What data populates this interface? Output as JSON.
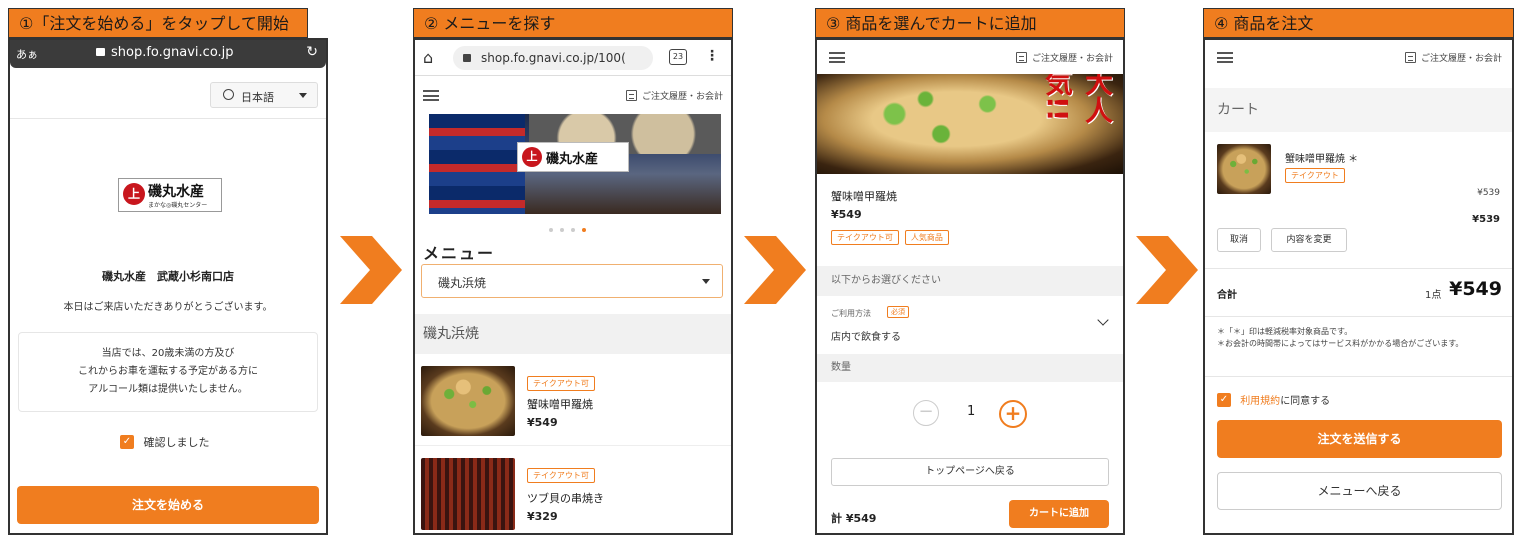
{
  "steps": [
    {
      "title": "①「注文を始める」をタップして開始"
    },
    {
      "title": "② メニューを探す"
    },
    {
      "title": "③ 商品を選んでカートに追加"
    },
    {
      "title": "④ 商品を注文"
    }
  ],
  "p1": {
    "kana": "あぁ",
    "url": "shop.fo.gnavi.co.jp",
    "lang": "日本語",
    "logo_main": "磯丸水産",
    "logo_sub": "まかな◎磯丸センター",
    "store": "磯丸水産　武蔵小杉南口店",
    "welcome": "本日はご来店いただきありがとうございます。",
    "notice": [
      "当店では、20歳未満の方及び",
      "これからお車を運転する予定がある方に",
      "アルコール類は提供いたしません。"
    ],
    "confirm": "確認しました",
    "start_button": "注文を始める"
  },
  "p2": {
    "url": "shop.fo.gnavi.co.jp/100(",
    "tabs": "23",
    "history": "ご注文履歴・お会計",
    "banner_logo": "磯丸水産",
    "menu_heading": "メニュー",
    "category_select": "磯丸浜焼",
    "category_header": "磯丸浜焼",
    "items": [
      {
        "tag": "テイクアウト可",
        "name": "蟹味噌甲羅焼",
        "price": "¥549"
      },
      {
        "tag": "テイクアウト可",
        "name": "ツブ貝の串焼き",
        "price": "¥329"
      }
    ]
  },
  "p3": {
    "history": "ご注文履歴・お会計",
    "banner_text": "大人気!!",
    "item_name": "蟹味噌甲羅焼",
    "item_price": "¥549",
    "tags": [
      "テイクアウト可",
      "人気商品"
    ],
    "choose_label": "以下からお選びください",
    "usage_label": "ご利用方法",
    "required": "必須",
    "usage_value": "店内で飲食する",
    "qty_label": "数量",
    "qty": "1",
    "back_top": "トップページへ戻る",
    "total": "計 ¥549",
    "add_cart": "カートに追加"
  },
  "p4": {
    "history": "ご注文履歴・お会計",
    "cart_title": "カート",
    "item_name": "蟹味噌甲羅焼 ＊",
    "item_tag": "テイクアウト",
    "item_price": "¥539",
    "item_total": "¥539",
    "cancel": "取消",
    "change": "内容を変更",
    "sum_label": "合計",
    "count": "1点",
    "sum_value": "¥549",
    "note1": "＊「＊」印は軽減税率対象商品です。",
    "note2": "＊お会計の時間帯によってはサービス料がかかる場合がございます。",
    "terms_link": "利用規約",
    "terms_rest": "に同意する",
    "submit": "注文を送信する",
    "back_menu": "メニューへ戻る"
  },
  "colors": {
    "accent": "#f07d1f"
  }
}
